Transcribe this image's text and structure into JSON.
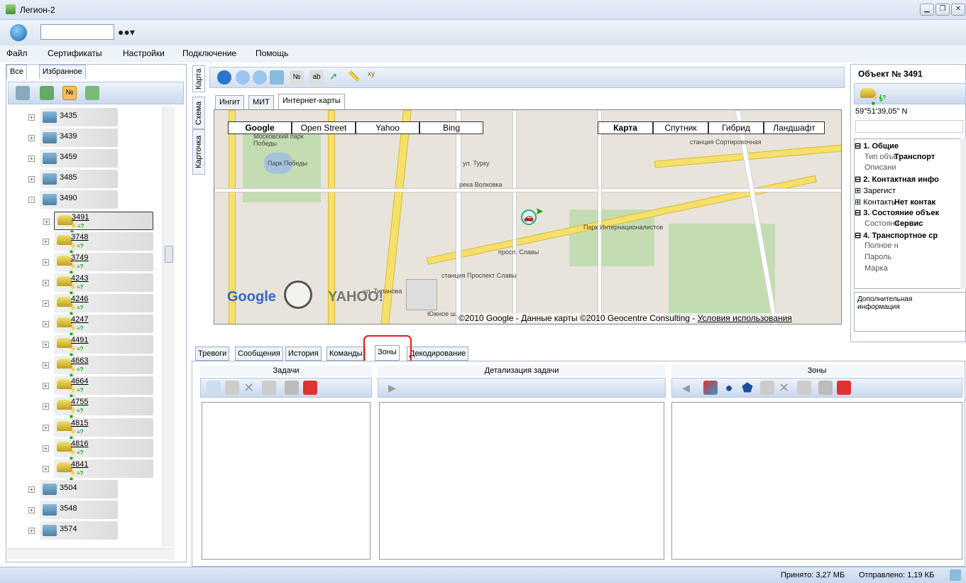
{
  "window": {
    "title": "Легион-2"
  },
  "menu": [
    "Файл",
    "Сертификаты",
    "Настройки",
    "Подключение",
    "Помощь"
  ],
  "left_tabs": [
    "Все",
    "Избранное"
  ],
  "tree": [
    {
      "id": "3435",
      "type": "group"
    },
    {
      "id": "3439",
      "type": "group"
    },
    {
      "id": "3459",
      "type": "group"
    },
    {
      "id": "3485",
      "type": "group"
    },
    {
      "id": "3490",
      "type": "group"
    },
    {
      "id": "3491",
      "type": "car",
      "selected": true
    },
    {
      "id": "3748",
      "type": "car"
    },
    {
      "id": "3749",
      "type": "car"
    },
    {
      "id": "4243",
      "type": "car"
    },
    {
      "id": "4246",
      "type": "car"
    },
    {
      "id": "4247",
      "type": "car"
    },
    {
      "id": "4491",
      "type": "car"
    },
    {
      "id": "4663",
      "type": "car"
    },
    {
      "id": "4664",
      "type": "car"
    },
    {
      "id": "4755",
      "type": "car"
    },
    {
      "id": "4815",
      "type": "car"
    },
    {
      "id": "4816",
      "type": "car"
    },
    {
      "id": "4841",
      "type": "car"
    },
    {
      "id": "3504",
      "type": "group"
    },
    {
      "id": "3548",
      "type": "group"
    },
    {
      "id": "3574",
      "type": "group"
    }
  ],
  "side_tabs": [
    "Карта",
    "Схема",
    "Карточка"
  ],
  "map_tabs": [
    "Ингит",
    "МИТ",
    "Интернет-карты"
  ],
  "providers": [
    "Google",
    "Open Street",
    "Yahoo",
    "Bing"
  ],
  "map_types": [
    "Карта",
    "Спутник",
    "Гибрид",
    "Ландшафт"
  ],
  "map_labels": [
    "Московский парк Победы",
    "Парк Победы",
    "ул. Турку",
    "станция Сортировочная",
    "река Волковка",
    "просп. Славы",
    "Парк Интернационалистов",
    "станция Проспект Славы",
    "ул. Типанова",
    "Южное ш."
  ],
  "map_copyright": "©2010 Google - Данные карты ©2010 Geocentre Consulting - ",
  "map_terms": "Условия использования",
  "object": {
    "title": "Объект № 3491",
    "coord": "59°51'39,05\" N"
  },
  "props": [
    {
      "label": "⊟ 1. Общие",
      "bold": true
    },
    {
      "label": "Тип объе",
      "value": "Транспорт"
    },
    {
      "label": "Описани",
      "value": ""
    },
    {
      "label": "⊟ 2. Контактная инфо",
      "bold": true
    },
    {
      "label": "⊞ Зарегист",
      "value": ""
    },
    {
      "label": "⊞ Контакть",
      "value": "Нет контак"
    },
    {
      "label": "⊟ 3. Состояние объек",
      "bold": true
    },
    {
      "label": "Состояни",
      "value": "Сервис"
    },
    {
      "label": "⊟ 4. Транспортное ср",
      "bold": true
    },
    {
      "label": "Полное н",
      "value": ""
    },
    {
      "label": "Пароль",
      "value": ""
    },
    {
      "label": "Марка",
      "value": ""
    }
  ],
  "extra_info": "Дополнительная информация",
  "bottom_tabs": [
    "Тревоги",
    "Сообщения",
    "История",
    "Команды",
    "Зоны",
    "Декодирование"
  ],
  "sections": [
    "Задачи",
    "Детализация задачи",
    "Зоны"
  ],
  "status": {
    "received": "Принято: 3,27 МБ",
    "sent": "Отправлено: 1,19 КБ"
  }
}
